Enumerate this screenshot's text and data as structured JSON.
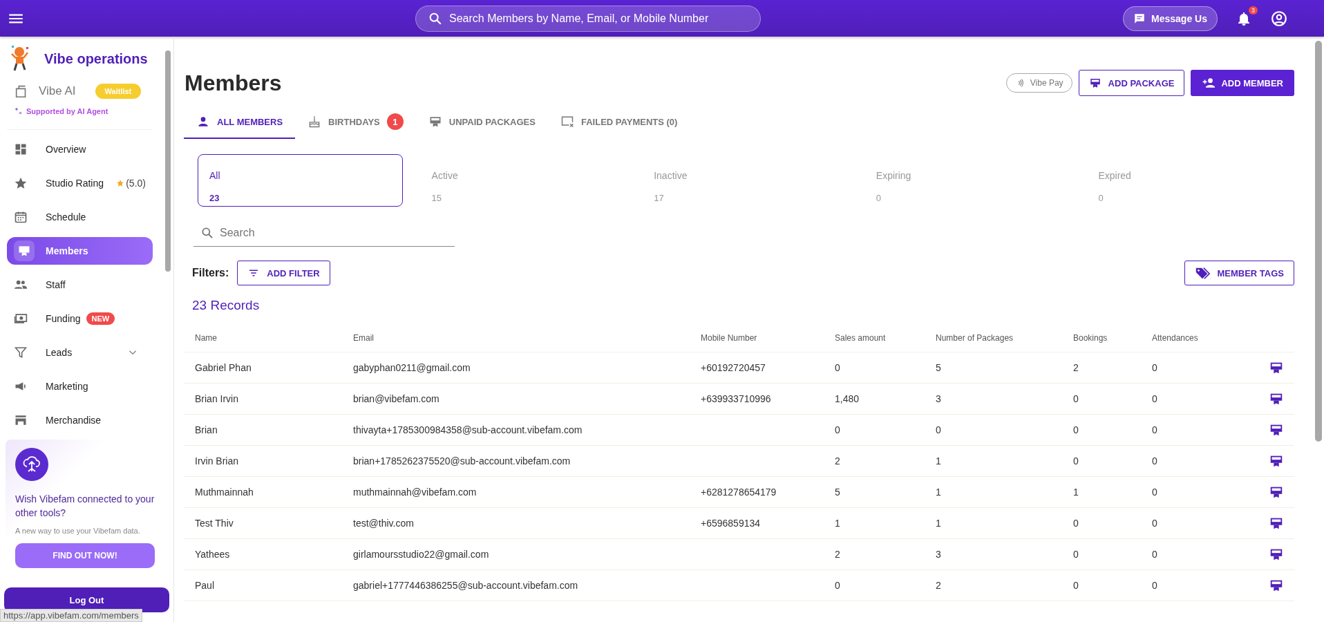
{
  "topbar": {
    "search_placeholder": "Search Members by Name, Email, or Mobile Number",
    "message_button": "Message Us",
    "notification_count": "3"
  },
  "sidebar": {
    "brand": "Vibe operations",
    "ai": {
      "label": "Vibe AI",
      "badge": "Waitlist",
      "note": "Supported by AI Agent"
    },
    "items": [
      {
        "kind": "overview",
        "label": "Overview",
        "selected": false
      },
      {
        "kind": "rating",
        "label": "Studio Rating",
        "selected": false,
        "rating": "(5.0)"
      },
      {
        "kind": "schedule",
        "label": "Schedule",
        "selected": false
      },
      {
        "kind": "members",
        "label": "Members",
        "selected": true
      },
      {
        "kind": "staff",
        "label": "Staff",
        "selected": false
      },
      {
        "kind": "funding",
        "label": "Funding",
        "selected": false,
        "badge": "NEW"
      },
      {
        "kind": "leads",
        "label": "Leads",
        "selected": false,
        "expanded": false
      },
      {
        "kind": "marketing",
        "label": "Marketing",
        "selected": false
      },
      {
        "kind": "merch",
        "label": "Merchandise",
        "selected": false
      }
    ],
    "promo": {
      "title": "Wish Vibefam connected to your other tools?",
      "text": "A new way to use your Vibefam data.",
      "button": "FIND OUT NOW!"
    },
    "logout": "Log Out",
    "status_url": "https://app.vibefam.com/members"
  },
  "page": {
    "title": "Members",
    "buttons": [
      {
        "kind": "pay",
        "label": "Vibe Pay"
      },
      {
        "kind": "outline",
        "label": "ADD PACKAGE"
      },
      {
        "kind": "filled",
        "label": "ADD MEMBER"
      }
    ],
    "tabs": [
      {
        "kind": "person",
        "label": "ALL MEMBERS",
        "selected": true
      },
      {
        "kind": "cake",
        "label": "BIRTHDAYS",
        "selected": false,
        "badge": "1"
      },
      {
        "kind": "card",
        "label": "UNPAID PACKAGES",
        "selected": false
      },
      {
        "kind": "failed",
        "label": "FAILED PAYMENTS (0)",
        "selected": false
      }
    ],
    "status_cards": [
      {
        "label": "All",
        "count": "23",
        "selected": true
      },
      {
        "label": "Active",
        "count": "15",
        "selected": false
      },
      {
        "label": "Inactive",
        "count": "17",
        "selected": false
      },
      {
        "label": "Expiring",
        "count": "0",
        "selected": false
      },
      {
        "label": "Expired",
        "count": "0",
        "selected": false
      }
    ],
    "search_placeholder": "Search",
    "filters_label": "Filters:",
    "add_filter": "ADD FILTER",
    "member_tags": "MEMBER TAGS",
    "records": "23 Records"
  },
  "table": {
    "columns": [
      "Name",
      "Email",
      "Mobile Number",
      "Sales amount",
      "Number of Packages",
      "Bookings",
      "Attendances"
    ],
    "rows": [
      [
        "Gabriel Phan",
        "gabyphan0211@gmail.com",
        "+60192720457",
        "0",
        "5",
        "2",
        "0"
      ],
      [
        "Brian Irvin",
        "brian@vibefam.com",
        "+639933710996",
        "1,480",
        "3",
        "0",
        "0"
      ],
      [
        "Brian",
        "thivayta+1785300984358@sub-account.vibefam.com",
        "",
        "0",
        "0",
        "0",
        "0"
      ],
      [
        "Irvin Brian",
        "brian+1785262375520@sub-account.vibefam.com",
        "",
        "2",
        "1",
        "0",
        "0"
      ],
      [
        "Muthmainnah",
        "muthmainnah@vibefam.com",
        "+6281278654179",
        "5",
        "1",
        "1",
        "0"
      ],
      [
        "Test Thiv",
        "test@thiv.com",
        "+6596859134",
        "1",
        "1",
        "0",
        "0"
      ],
      [
        "Yathees",
        "girlamoursstudio22@gmail.com",
        "",
        "2",
        "3",
        "0",
        "0"
      ],
      [
        "Paul",
        "gabriel+1777446386255@sub-account.vibefam.com",
        "",
        "0",
        "2",
        "0",
        "0"
      ]
    ]
  }
}
